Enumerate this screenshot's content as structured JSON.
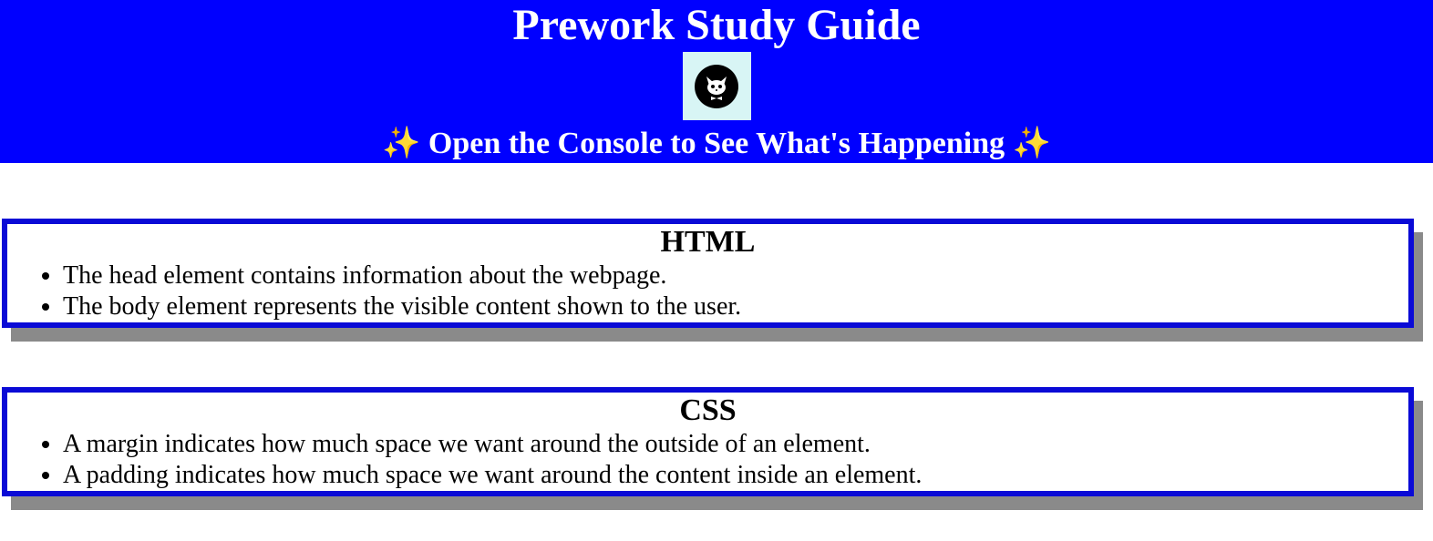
{
  "header": {
    "title": "Prework Study Guide",
    "avatar_icon": "cat-avatar-icon",
    "subtitle_left_emoji": "✨",
    "subtitle": "Open the Console to See What's Happening",
    "subtitle_right_emoji": "✨",
    "background_color": "#0000ff"
  },
  "sections": [
    {
      "title": "HTML",
      "items": [
        "The head element contains information about the webpage.",
        "The body element represents the visible content shown to the user."
      ]
    },
    {
      "title": "CSS",
      "items": [
        "A margin indicates how much space we want around the outside of an element.",
        "A padding indicates how much space we want around the content inside an element."
      ]
    }
  ],
  "colors": {
    "section_border": "#0a0ad6",
    "shadow": "#8a8a8a"
  }
}
